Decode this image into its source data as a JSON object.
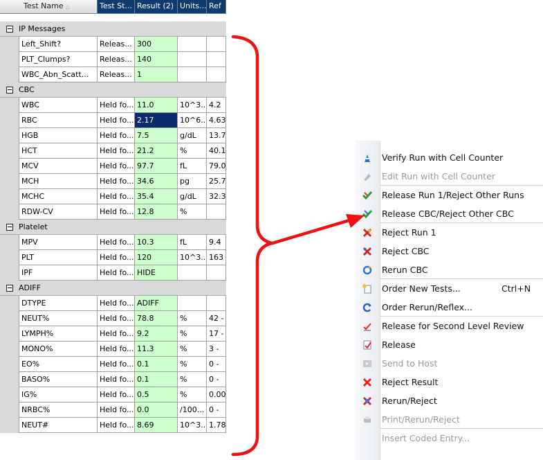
{
  "grid": {
    "columns": [
      "Test Name",
      "Test St...",
      "Result (2)",
      "Units...",
      "Ref"
    ],
    "sort_indicator": "△",
    "groups": [
      {
        "label": "IP Messages",
        "rows": [
          {
            "name": "Left_Shift?",
            "status": "Releas...",
            "result": "300",
            "units": "",
            "ref": ""
          },
          {
            "name": "PLT_Clumps?",
            "status": "Releas...",
            "result": "140",
            "units": "",
            "ref": ""
          },
          {
            "name": "WBC_Abn_Scatt...",
            "status": "Releas...",
            "result": "1",
            "units": "",
            "ref": ""
          }
        ]
      },
      {
        "label": "CBC",
        "rows": [
          {
            "name": "WBC",
            "status": "Held fo...",
            "result": "11.0",
            "units": "10^3...",
            "ref": "4.2"
          },
          {
            "name": "RBC",
            "status": "Held fo...",
            "result": "2.17",
            "units": "10^6...",
            "ref": "4.63",
            "selected": true
          },
          {
            "name": "HGB",
            "status": "Held fo...",
            "result": "7.5",
            "units": "g/dL",
            "ref": "13.7"
          },
          {
            "name": "HCT",
            "status": "Held fo...",
            "result": "21.2",
            "units": "%",
            "ref": "40.1"
          },
          {
            "name": "MCV",
            "status": "Held fo...",
            "result": "97.7",
            "units": "fL",
            "ref": "79.0"
          },
          {
            "name": "MCH",
            "status": "Held fo...",
            "result": "34.6",
            "units": "pg",
            "ref": "25.7"
          },
          {
            "name": "MCHC",
            "status": "Held fo...",
            "result": "35.4",
            "units": "g/dL",
            "ref": "32.3"
          },
          {
            "name": "RDW-CV",
            "status": "Held fo...",
            "result": "12.8",
            "units": "%",
            "ref": ""
          }
        ]
      },
      {
        "label": "Platelet",
        "rows": [
          {
            "name": "MPV",
            "status": "Held fo...",
            "result": "10.3",
            "units": "fL",
            "ref": "9.4"
          },
          {
            "name": "PLT",
            "status": "Held fo...",
            "result": "120",
            "units": "10^3...",
            "ref": "163"
          },
          {
            "name": "IPF",
            "status": "Held fo...",
            "result": "HIDE",
            "units": "",
            "ref": ""
          }
        ]
      },
      {
        "label": "ADIFF",
        "rows": [
          {
            "name": "DTYPE",
            "status": "Held fo...",
            "result": "ADIFF",
            "units": "",
            "ref": ""
          },
          {
            "name": "NEUT%",
            "status": "Held fo...",
            "result": "78.8",
            "units": "%",
            "ref": "42 -"
          },
          {
            "name": "LYMPH%",
            "status": "Held fo...",
            "result": "9.2",
            "units": "%",
            "ref": "17 -"
          },
          {
            "name": "MONO%",
            "status": "Held fo...",
            "result": "11.3",
            "units": "%",
            "ref": "3 -"
          },
          {
            "name": "EO%",
            "status": "Held fo...",
            "result": "0.1",
            "units": "%",
            "ref": "0 -"
          },
          {
            "name": "BASO%",
            "status": "Held fo...",
            "result": "0.1",
            "units": "%",
            "ref": "0 -"
          },
          {
            "name": "IG%",
            "status": "Held fo...",
            "result": "0.5",
            "units": "%",
            "ref": "0.00"
          },
          {
            "name": "NRBC%",
            "status": "Held fo...",
            "result": "0.0",
            "units": "/100...",
            "ref": "0 -"
          },
          {
            "name": "NEUT#",
            "status": "Held fo...",
            "result": "8.69",
            "units": "10^3...",
            "ref": "1.78"
          }
        ]
      }
    ]
  },
  "menu": {
    "items": [
      {
        "label": "Verify Run with Cell Counter",
        "icon": "verify-run-icon",
        "disabled": false
      },
      {
        "label": "Edit Run with Cell Counter",
        "icon": "edit-run-icon",
        "disabled": true
      },
      {
        "sep": true
      },
      {
        "label": "Release Run 1/Reject Other Runs",
        "icon": "release-run-icon",
        "disabled": false
      },
      {
        "label": "Release CBC/Reject Other CBC",
        "icon": "release-cbc-icon",
        "disabled": false
      },
      {
        "sep": true
      },
      {
        "label": "Reject Run 1",
        "icon": "reject-run-icon",
        "disabled": false
      },
      {
        "label": "Reject CBC",
        "icon": "reject-cbc-icon",
        "disabled": false
      },
      {
        "label": "Rerun CBC",
        "icon": "rerun-cbc-icon",
        "disabled": false
      },
      {
        "sep": true
      },
      {
        "label": "Order New Tests...",
        "icon": "order-new-tests-icon",
        "disabled": false,
        "shortcut": "Ctrl+N"
      },
      {
        "label": "Order Rerun/Reflex...",
        "icon": "order-rerun-icon",
        "disabled": false
      },
      {
        "sep": true
      },
      {
        "label": "Release for Second Level Review",
        "icon": "second-review-icon",
        "disabled": false
      },
      {
        "label": "Release",
        "icon": "release-icon",
        "disabled": false
      },
      {
        "label": "Send to Host",
        "icon": "send-to-host-icon",
        "disabled": true
      },
      {
        "label": "Reject Result",
        "icon": "reject-result-icon",
        "disabled": false
      },
      {
        "label": "Rerun/Reject",
        "icon": "rerun-reject-icon",
        "disabled": false
      },
      {
        "label": "Print/Rerun/Reject",
        "icon": "print-rerun-reject-icon",
        "disabled": true
      },
      {
        "sep": true
      },
      {
        "label": "Insert Coded Entry...",
        "icon": "",
        "disabled": true
      }
    ]
  },
  "colors": {
    "header_dark": "#0e3a6e",
    "result_green": "#ccffcc",
    "selected_cell": "#0b2a6b",
    "annotation_red": "#ee1111"
  }
}
